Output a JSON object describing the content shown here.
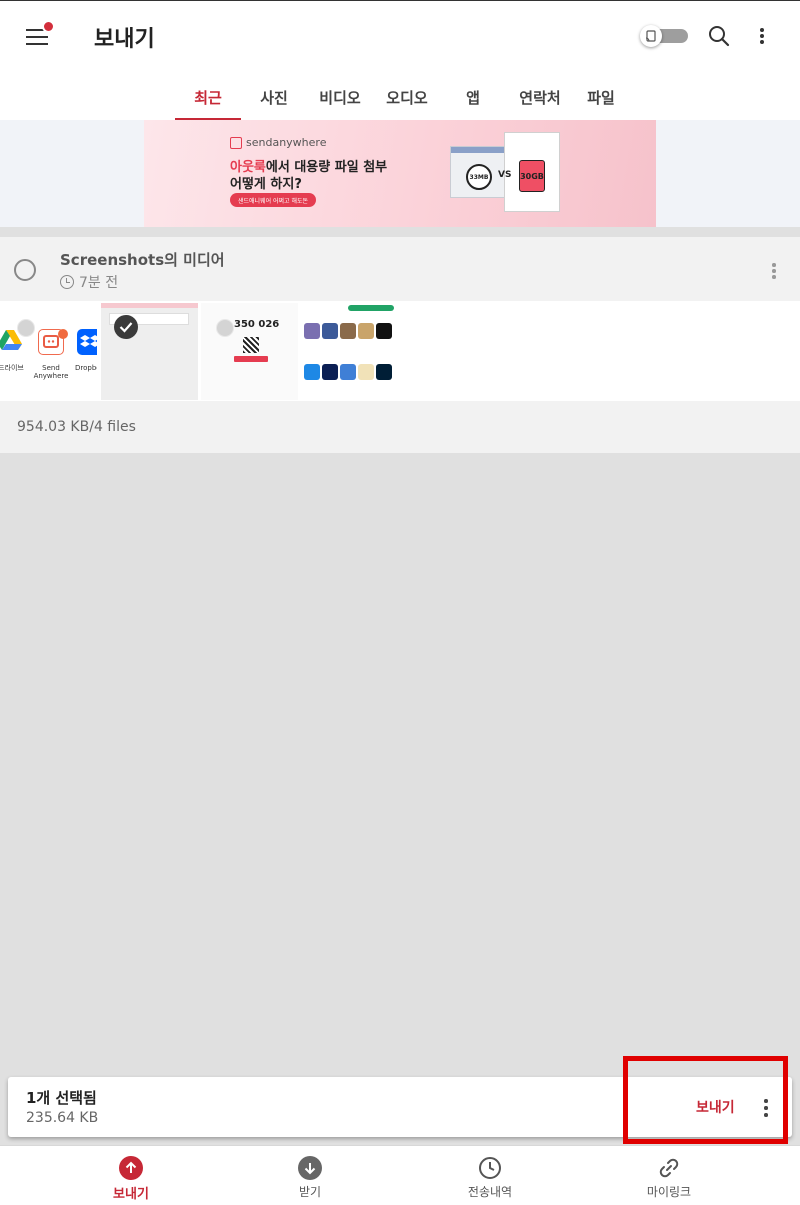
{
  "app": {
    "title": "보내기",
    "accent_color": "#c62836",
    "menu_icon": "hamburger-menu-icon",
    "cast_icon": "cast-icon",
    "search_icon": "search-icon",
    "more_icon": "more-vertical-icon"
  },
  "tabs": [
    {
      "label": "최근",
      "active": true
    },
    {
      "label": "사진",
      "active": false
    },
    {
      "label": "비디오",
      "active": false
    },
    {
      "label": "오디오",
      "active": false
    },
    {
      "label": "앱",
      "active": false
    },
    {
      "label": "연락처",
      "active": false
    },
    {
      "label": "파일",
      "active": false
    }
  ],
  "banner": {
    "brand": "sendanywhere",
    "headline_highlight": "아웃룩",
    "headline_rest": "에서 대용량 파일 첨부",
    "subline": "어떻게 하지?",
    "cta": "샌드애니웨어 어쩌고 해도돈",
    "compare_small": "33MB",
    "compare_vs": "VS",
    "compare_large": "30GB"
  },
  "album": {
    "title": "Screenshots의 미디어",
    "time_ago": "7분 전",
    "size_summary": "954.03 KB/4 files",
    "thumbnails": [
      {
        "selected": false,
        "apps": [
          {
            "label": "드라이브",
            "icon": "google-drive-icon"
          },
          {
            "label": "Send\nAnywhere",
            "icon": "send-anywhere-icon"
          },
          {
            "label": "Dropbo",
            "icon": "dropbox-icon"
          }
        ]
      },
      {
        "selected": true
      },
      {
        "selected": false,
        "code": "350 026"
      },
      {
        "selected": false
      }
    ]
  },
  "selection": {
    "count_label": "1개 선택됨",
    "size": "235.64 KB",
    "send_label": "보내기"
  },
  "bottom_nav": [
    {
      "label": "보내기",
      "icon": "upload-arrow-icon",
      "active": true
    },
    {
      "label": "받기",
      "icon": "download-arrow-icon",
      "active": false
    },
    {
      "label": "전송내역",
      "icon": "history-clock-icon",
      "active": false
    },
    {
      "label": "마이링크",
      "icon": "link-icon",
      "active": false
    }
  ]
}
